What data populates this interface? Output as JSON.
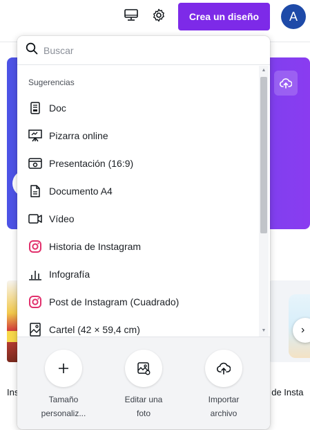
{
  "topbar": {
    "cta_label": "Crea un diseño",
    "avatar_initial": "A",
    "icons": [
      "monitor-icon",
      "gear-icon"
    ],
    "accent_color": "#7d2ae8",
    "avatar_color": "#1e4aa8"
  },
  "search": {
    "placeholder": "Buscar",
    "value": ""
  },
  "suggestions": {
    "title": "Sugerencias",
    "items": [
      {
        "label": "Doc",
        "icon": "doc-icon"
      },
      {
        "label": "Pizarra online",
        "icon": "whiteboard-icon"
      },
      {
        "label": "Presentación (16:9)",
        "icon": "presentation-icon"
      },
      {
        "label": "Documento A4",
        "icon": "document-icon"
      },
      {
        "label": "Vídeo",
        "icon": "video-icon"
      },
      {
        "label": "Historia de Instagram",
        "icon": "instagram-icon"
      },
      {
        "label": "Infografía",
        "icon": "chart-bars-icon"
      },
      {
        "label": "Post de Instagram (Cuadrado)",
        "icon": "instagram-icon"
      },
      {
        "label": "Cartel (42 × 59,4 cm)",
        "icon": "poster-icon"
      }
    ]
  },
  "footer": {
    "custom_size": {
      "line1": "Tamaño",
      "line2": "personaliz...",
      "icon": "plus-icon"
    },
    "edit_photo": {
      "line1": "Editar una",
      "line2": "foto",
      "icon": "image-edit-icon"
    },
    "import_file": {
      "line1": "Importar",
      "line2": "archivo",
      "icon": "cloud-upload-icon"
    }
  },
  "background": {
    "left_label": "Ins",
    "right_label": "t de Insta"
  }
}
